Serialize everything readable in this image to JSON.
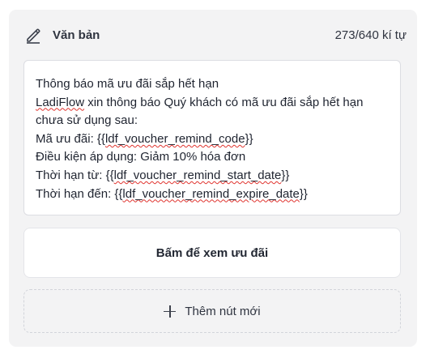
{
  "header": {
    "title": "Văn bản",
    "char_count": "273/640 kí tự",
    "icon": "pencil-icon"
  },
  "message": {
    "line1": "Thông báo mã ưu đãi sắp hết hạn",
    "line2_word": "LadiFlow",
    "line2_rest": " xin thông báo Quý khách có mã ưu đãi sắp hết hạn",
    "line3": "chưa sử dụng sau:",
    "line4_prefix": "Mã ưu đãi: {{",
    "line4_var": "ldf_voucher_remind_code",
    "line4_suffix": "}}",
    "line5": "Điều kiện áp dụng: Giảm 10% hóa đơn",
    "line6_prefix": "Thời hạn từ: {{",
    "line6_var": "ldf_voucher_remind_start_date",
    "line6_suffix": "}}",
    "line7_prefix": "Thời hạn đến: {{",
    "line7_var": "ldf_voucher_remind_expire_date",
    "line7_suffix": "}}"
  },
  "button": {
    "label": "Bấm để xem ưu đãi"
  },
  "add_button": {
    "label": "Thêm nút mới",
    "icon": "plus-icon"
  },
  "colors": {
    "panel_bg": "#f3f3f4",
    "spellcheck_underline": "#e0332e"
  }
}
